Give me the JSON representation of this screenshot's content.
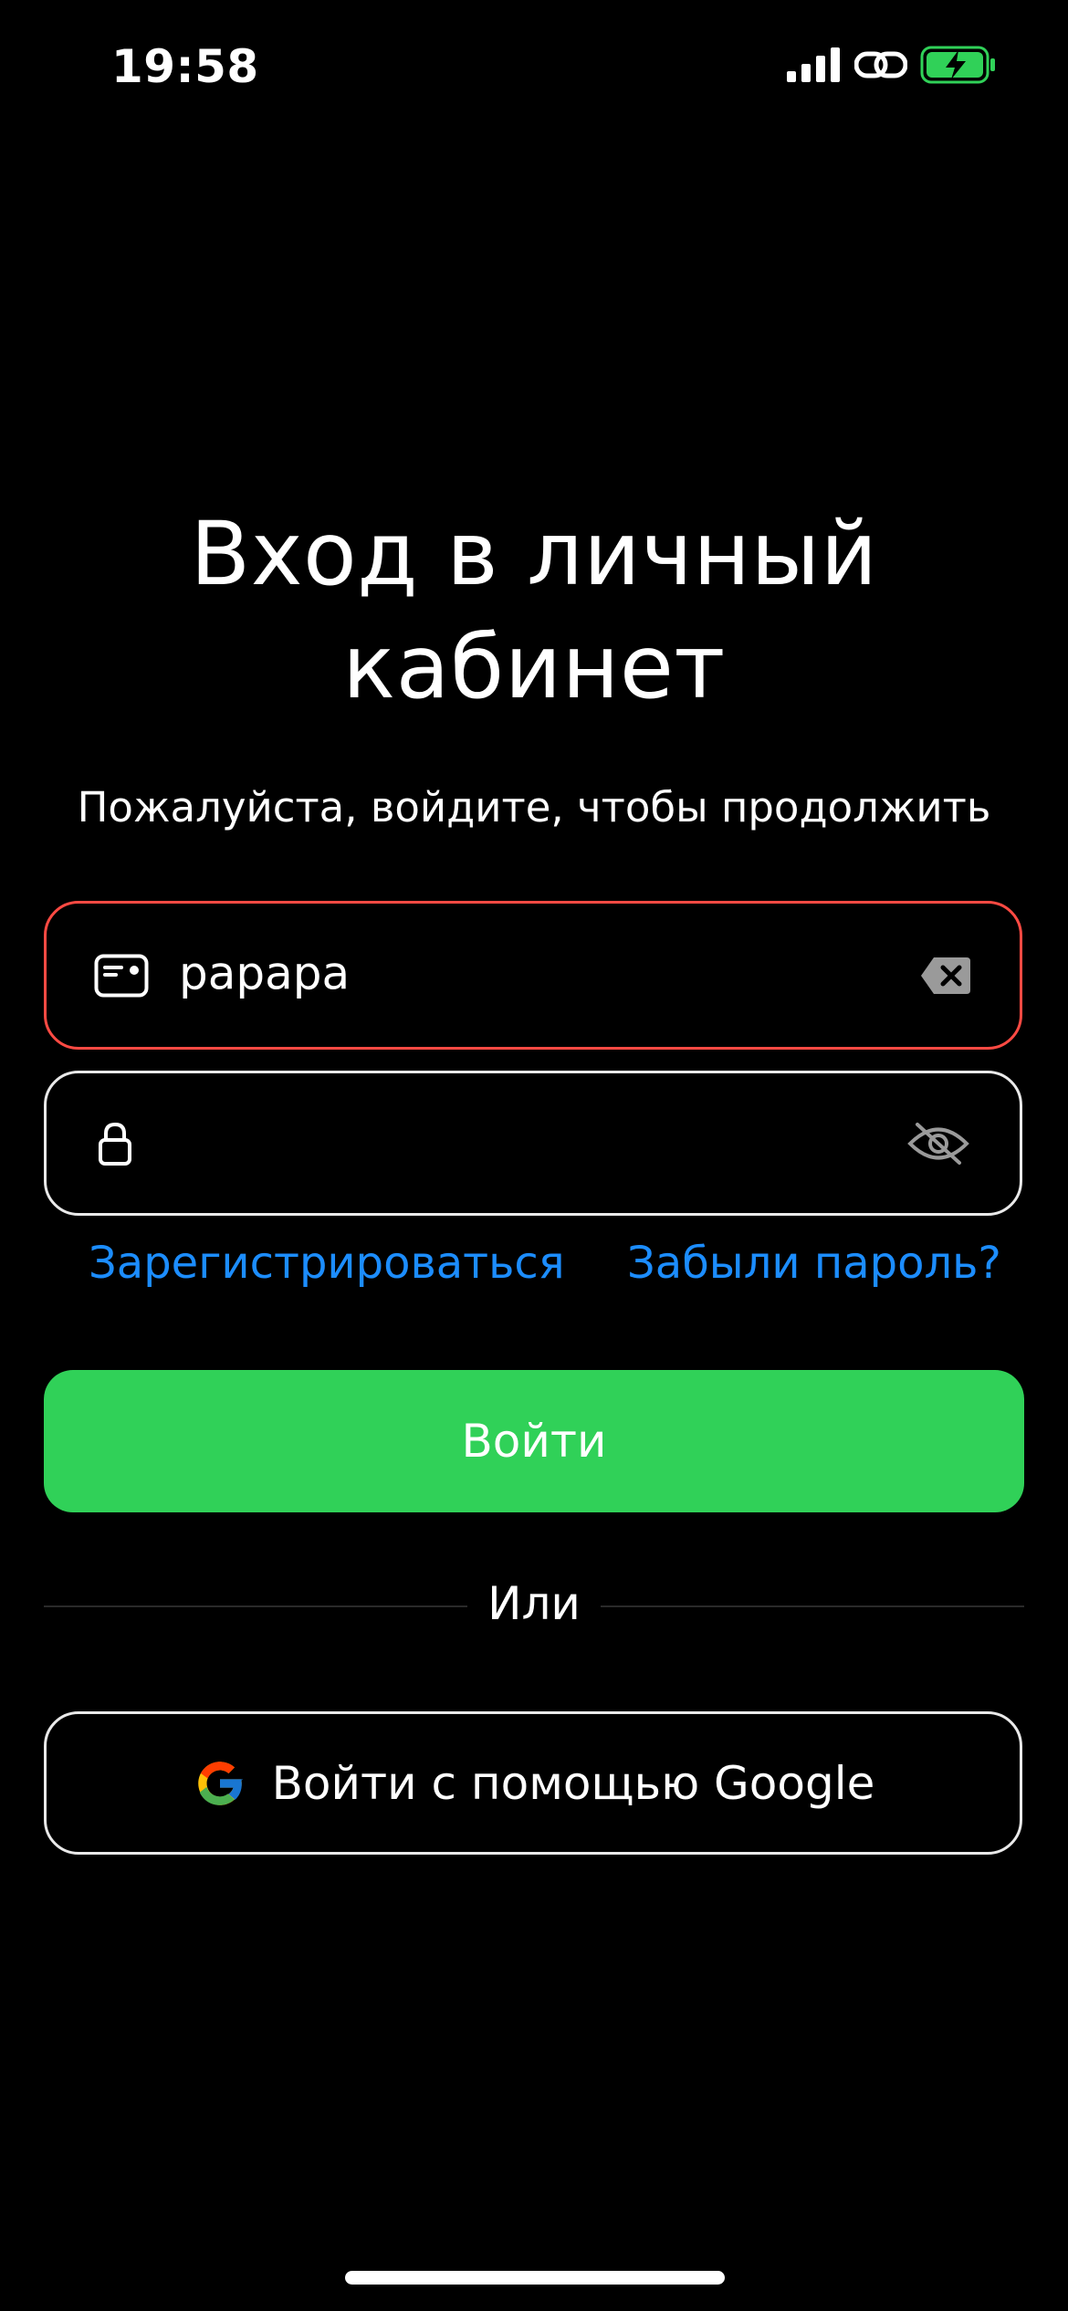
{
  "status_bar": {
    "time": "19:58",
    "icons": [
      "cellular-signal-icon",
      "link-icon",
      "battery-charging-icon"
    ],
    "battery_color": "#30d158"
  },
  "header": {
    "title_line1": "Вход в личный",
    "title_line2": "кабинет",
    "subtitle": "Пожалуйста, войдите, чтобы продолжить"
  },
  "form": {
    "login": {
      "value": "papapa",
      "icon": "id-card-icon",
      "clear_icon": "clear-text-icon",
      "border_color": "#ff4a43"
    },
    "password": {
      "value": "",
      "icon": "lock-icon",
      "toggle_icon": "eye-slash-icon"
    },
    "register_link": "Зарегистрироваться",
    "forgot_link": "Забыли пароль?",
    "submit_label": "Войти"
  },
  "divider_label": "Или",
  "google": {
    "label": "Войти с помощью Google",
    "icon": "google-logo-icon"
  },
  "colors": {
    "accent_green": "#30d158",
    "link_blue": "#1c8dff",
    "error_red": "#ff4a43",
    "background": "#000000"
  }
}
